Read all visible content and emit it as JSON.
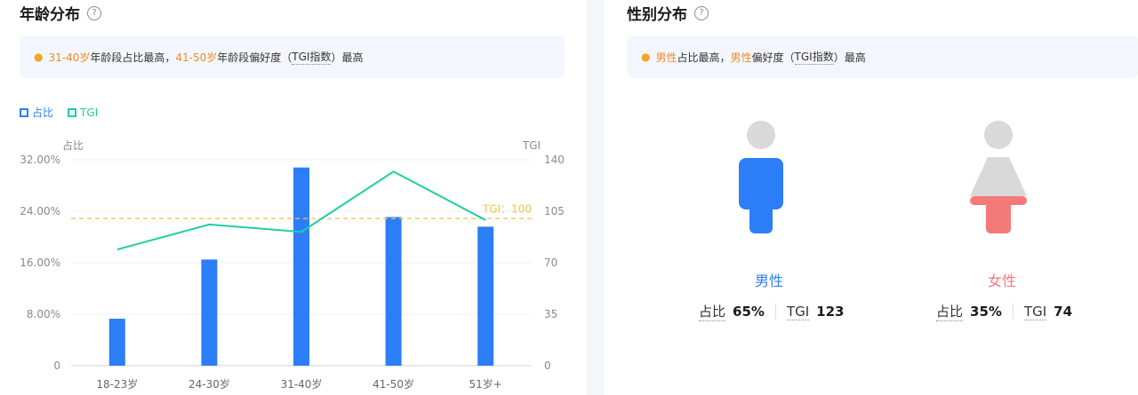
{
  "age": {
    "title": "年龄分布",
    "help_icon": "question-circle-icon",
    "insight": {
      "bulb_icon": "lightbulb-icon",
      "hl1": "31-40岁",
      "t1": "年龄段占比最高，",
      "hl2": "41-50岁",
      "t2": "年龄段偏好度（",
      "tgi_link": "TGI指数",
      "t3": "）最高"
    },
    "legend": {
      "share": "占比",
      "tgi": "TGI"
    },
    "colors": {
      "bar": "#2c7ef8",
      "line": "#1ccfa0",
      "ref": "#f5c242"
    }
  },
  "gender": {
    "title": "性别分布",
    "help_icon": "question-circle-icon",
    "insight": {
      "bulb_icon": "lightbulb-icon",
      "hl1": "男性",
      "t1": "占比最高，",
      "hl2": "男性",
      "t2": "偏好度（",
      "tgi_link": "TGI指数",
      "t3": "）最高"
    },
    "male": {
      "label": "男性",
      "share_label": "占比",
      "share": "65%",
      "tgi_label": "TGI",
      "tgi": "123",
      "color": "#2c7ef8",
      "icon": "male-person-icon"
    },
    "female": {
      "label": "女性",
      "share_label": "占比",
      "share": "35%",
      "tgi_label": "TGI",
      "tgi": "74",
      "color": "#f47a7a",
      "icon": "female-person-icon"
    }
  },
  "chart_data": {
    "type": "bar",
    "categories": [
      "18-23岁",
      "24-30岁",
      "31-40岁",
      "41-50岁",
      "51岁+"
    ],
    "series": [
      {
        "name": "占比",
        "type": "bar",
        "axis": "left",
        "values": [
          7.3,
          16.5,
          30.8,
          23.1,
          21.6
        ]
      },
      {
        "name": "TGI",
        "type": "line",
        "axis": "right",
        "values": [
          79,
          96,
          91,
          132,
          99
        ]
      }
    ],
    "ylabel": "占比",
    "y2label": "TGI",
    "ylim": [
      0,
      32
    ],
    "y2lim": [
      0,
      140
    ],
    "yticks": [
      "0",
      "8.00%",
      "16.00%",
      "24.00%",
      "32.00%"
    ],
    "y2ticks": [
      "0",
      "35",
      "70",
      "105",
      "140"
    ],
    "reference_line": {
      "label": "TGI：100",
      "value": 100,
      "axis": "right"
    },
    "grid": true
  }
}
